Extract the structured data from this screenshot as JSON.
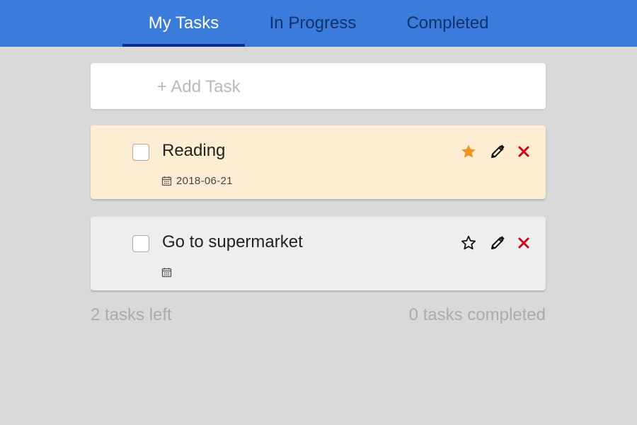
{
  "tabs": [
    {
      "label": "My Tasks",
      "active": true
    },
    {
      "label": "In Progress",
      "active": false
    },
    {
      "label": "Completed",
      "active": false
    }
  ],
  "add_task": {
    "placeholder": "+ Add Task",
    "value": ""
  },
  "tasks": [
    {
      "title": "Reading",
      "date": "2018-06-21",
      "starred": true,
      "checked": false
    },
    {
      "title": "Go to supermarket",
      "date": "",
      "starred": false,
      "checked": false
    }
  ],
  "footer": {
    "left_text": "2 tasks left",
    "right_text": "0 tasks completed"
  },
  "colors": {
    "header": "#3a7bdb",
    "tab_active_text": "#ffffff",
    "tab_inactive_text": "#14306e",
    "starred_card": "#fdedd3",
    "normal_card": "#eeeeee",
    "star_active": "#f0931e",
    "delete": "#d0021b"
  },
  "icons": {
    "calendar": "calendar-icon",
    "star": "star-icon",
    "edit": "pencil-icon",
    "delete": "close-icon"
  }
}
